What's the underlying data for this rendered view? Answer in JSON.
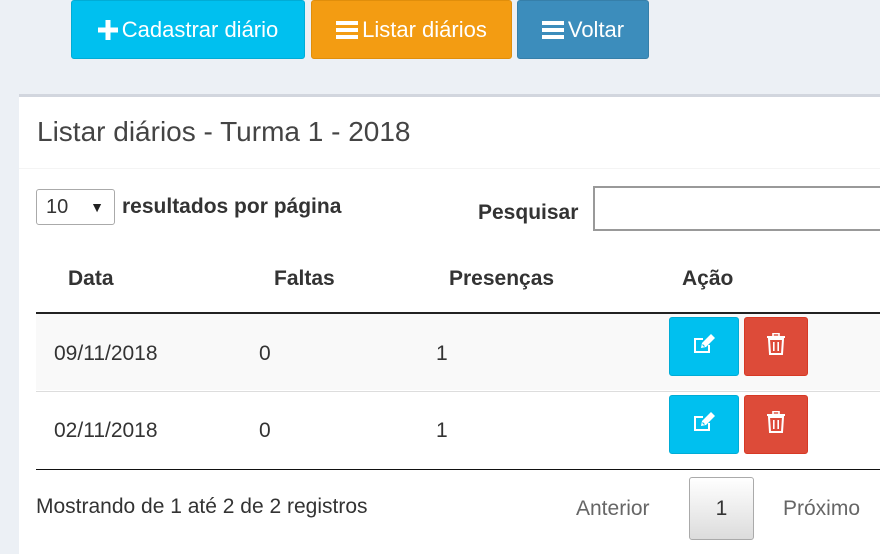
{
  "toolbar": {
    "cadastrar_label": "Cadastrar diário",
    "listar_label": "Listar diários",
    "voltar_label": "Voltar"
  },
  "box": {
    "title": "Listar diários - Turma 1 - 2018"
  },
  "controls": {
    "page_length": "10",
    "page_length_label": "resultados por página",
    "search_label": "Pesquisar",
    "search_value": ""
  },
  "table": {
    "headers": {
      "data": "Data",
      "faltas": "Faltas",
      "presencas": "Presenças",
      "acao": "Ação"
    },
    "rows": [
      {
        "data": "09/11/2018",
        "faltas": "0",
        "presencas": "1"
      },
      {
        "data": "02/11/2018",
        "faltas": "0",
        "presencas": "1"
      }
    ]
  },
  "footer": {
    "info": "Mostrando de 1 até 2 de 2 registros",
    "prev": "Anterior",
    "page": "1",
    "next": "Próximo"
  },
  "colors": {
    "info": "#00c0ef",
    "warning": "#f39c12",
    "primary": "#3c8dbc",
    "danger": "#dd4b39",
    "background": "#ecf0f5"
  },
  "icons": {
    "cadastrar": "plus-icon",
    "listar": "list-icon",
    "voltar": "list-icon",
    "edit": "edit-icon",
    "delete": "trash-icon"
  }
}
